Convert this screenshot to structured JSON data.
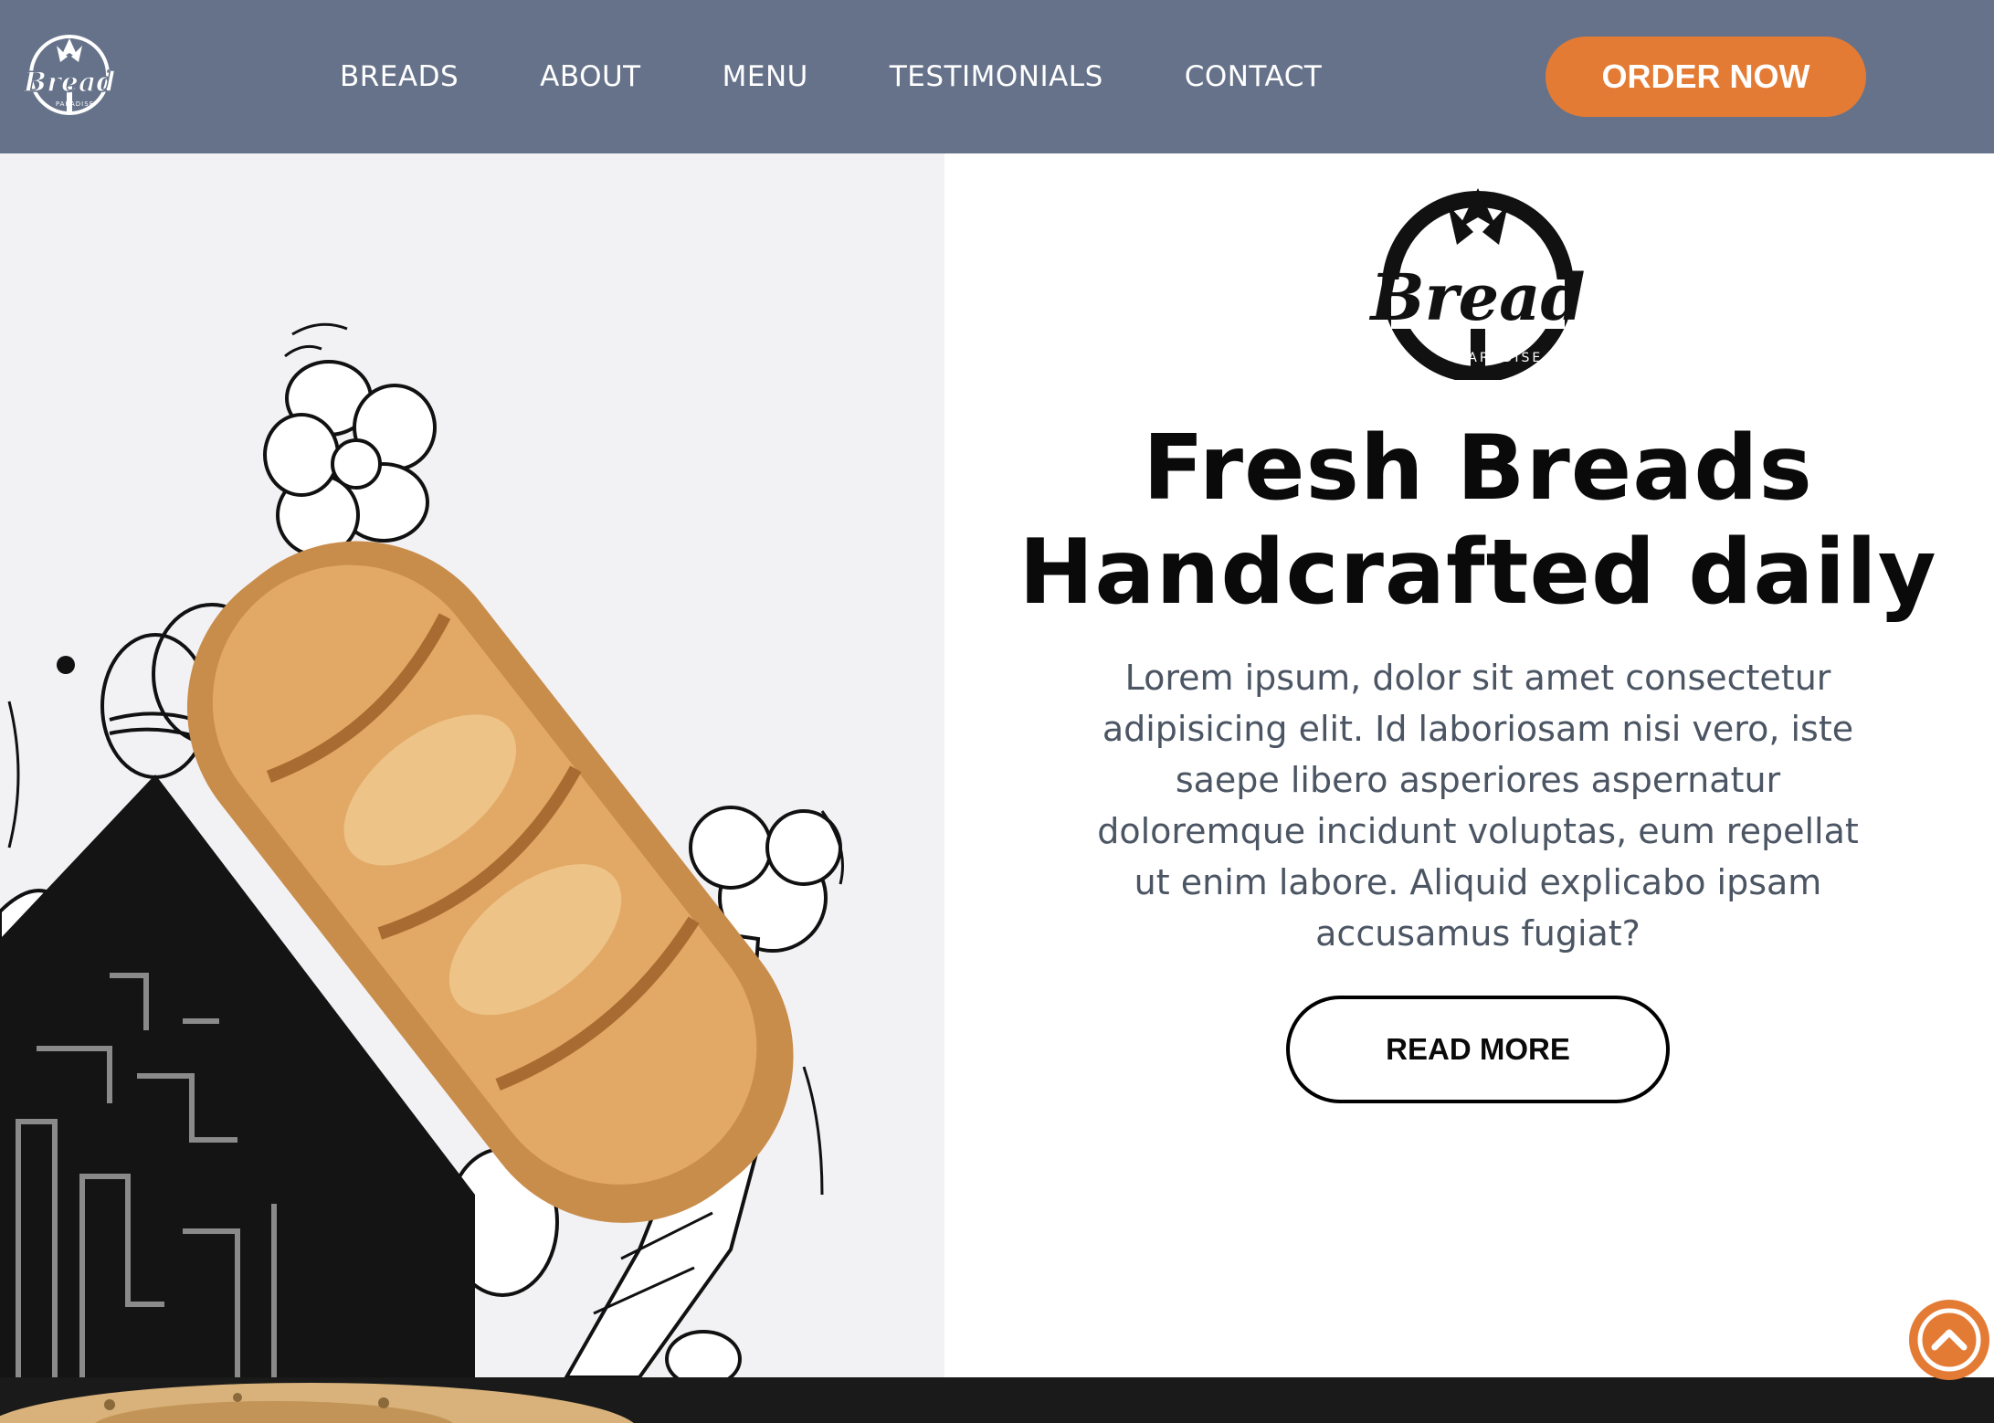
{
  "header": {
    "logo": {
      "word": "Bread",
      "sub": "PARADISE"
    },
    "nav": [
      "BREADS",
      "ABOUT",
      "MENU",
      "TESTIMONIALS",
      "CONTACT"
    ],
    "order_label": "ORDER NOW"
  },
  "hero": {
    "logo": {
      "word": "Bread",
      "sub": "PARADISE"
    },
    "title_line1": "Fresh Breads",
    "title_line2": "Handcrafted daily",
    "description": "Lorem ipsum, dolor sit amet consectetur adipisicing elit. Id laboriosam nisi vero, iste saepe libero asperiores aspernatur doloremque incidunt voluptas, eum repellat ut enim labore. Aliquid explicabo ipsam accusamus fugiat?",
    "read_more_label": "READ MORE"
  },
  "colors": {
    "header_bg": "#65728a",
    "accent": "#e47b34",
    "text_dark": "#0a0a0a",
    "text_muted": "#4b5563"
  },
  "icons": {
    "scroll_top": "chevron-up-circle-icon"
  }
}
